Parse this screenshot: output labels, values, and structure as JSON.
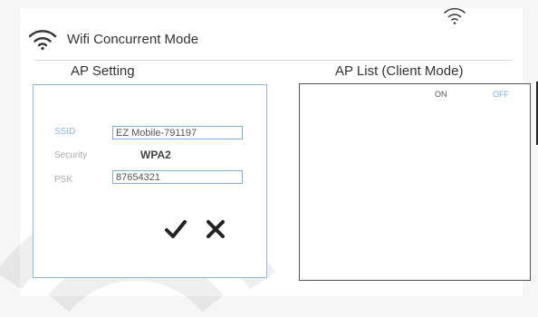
{
  "header": {
    "title": "Wifi Concurrent Mode",
    "icon": "wifi-icon",
    "status_icon": "wifi-icon"
  },
  "ap_setting": {
    "section_label": "AP Setting",
    "ssid_label": "SSID",
    "ssid_value": "EZ Mobile-791197",
    "security_label": "Security",
    "security_value": "WPA2",
    "psk_label": "PSK",
    "psk_value": "87654321",
    "confirm_icon": "checkmark-icon",
    "cancel_icon": "close-icon"
  },
  "ap_list": {
    "section_label": "AP List (Client Mode)",
    "toggle_on_label": "ON",
    "toggle_off_label": "OFF",
    "selected": "OFF"
  },
  "colors": {
    "panel_border": "#8cb9df",
    "accent": "#7aaee0",
    "icon": "#333333"
  }
}
